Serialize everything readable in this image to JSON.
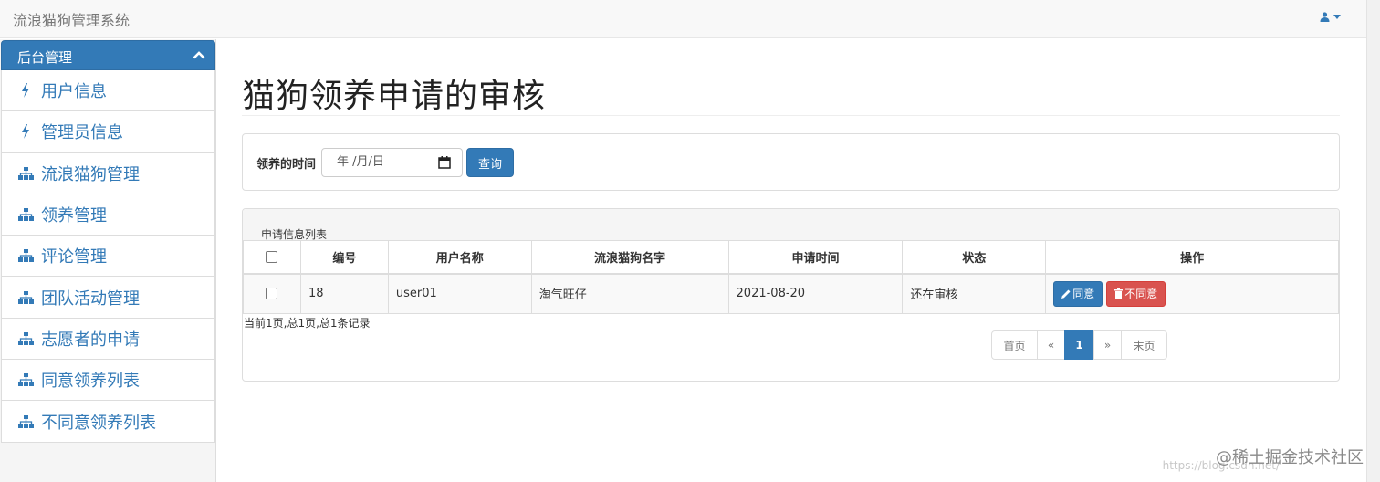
{
  "navbar": {
    "brand": "流浪猫狗管理系统"
  },
  "sidebar": {
    "header": "后台管理",
    "items": [
      {
        "label": "用户信息",
        "icon": "flash-icon"
      },
      {
        "label": "管理员信息",
        "icon": "flash-icon"
      },
      {
        "label": "流浪猫狗管理",
        "icon": "sitemap-icon"
      },
      {
        "label": "领养管理",
        "icon": "sitemap-icon"
      },
      {
        "label": "评论管理",
        "icon": "sitemap-icon"
      },
      {
        "label": "团队活动管理",
        "icon": "sitemap-icon"
      },
      {
        "label": "志愿者的申请",
        "icon": "sitemap-icon"
      },
      {
        "label": "同意领养列表",
        "icon": "sitemap-icon"
      },
      {
        "label": "不同意领养列表",
        "icon": "sitemap-icon"
      }
    ]
  },
  "main": {
    "title": "猫狗领养申请的审核",
    "search": {
      "label": "领养的时间",
      "date_placeholder": "年 /月/日",
      "query_label": "查询"
    },
    "list": {
      "heading": "申请信息列表",
      "columns": [
        "编号",
        "用户名称",
        "流浪猫狗名字",
        "申请时间",
        "状态",
        "操作"
      ],
      "rows": [
        {
          "id": "18",
          "user": "user01",
          "pet": "淘气旺仔",
          "date": "2021-08-20",
          "status": "还在审核",
          "agree": "同意",
          "reject": "不同意"
        }
      ],
      "page_info": "当前1页,总1页,总1条记录",
      "pager": {
        "first": "首页",
        "prev": "«",
        "current": "1",
        "next": "»",
        "last": "末页"
      }
    }
  },
  "watermark": {
    "text": "@稀土掘金技术社区",
    "url": "https://blog.csdn.net/"
  },
  "colors": {
    "primary": "#337ab7",
    "danger": "#d9534f",
    "navbar": "#f8f8f8"
  }
}
